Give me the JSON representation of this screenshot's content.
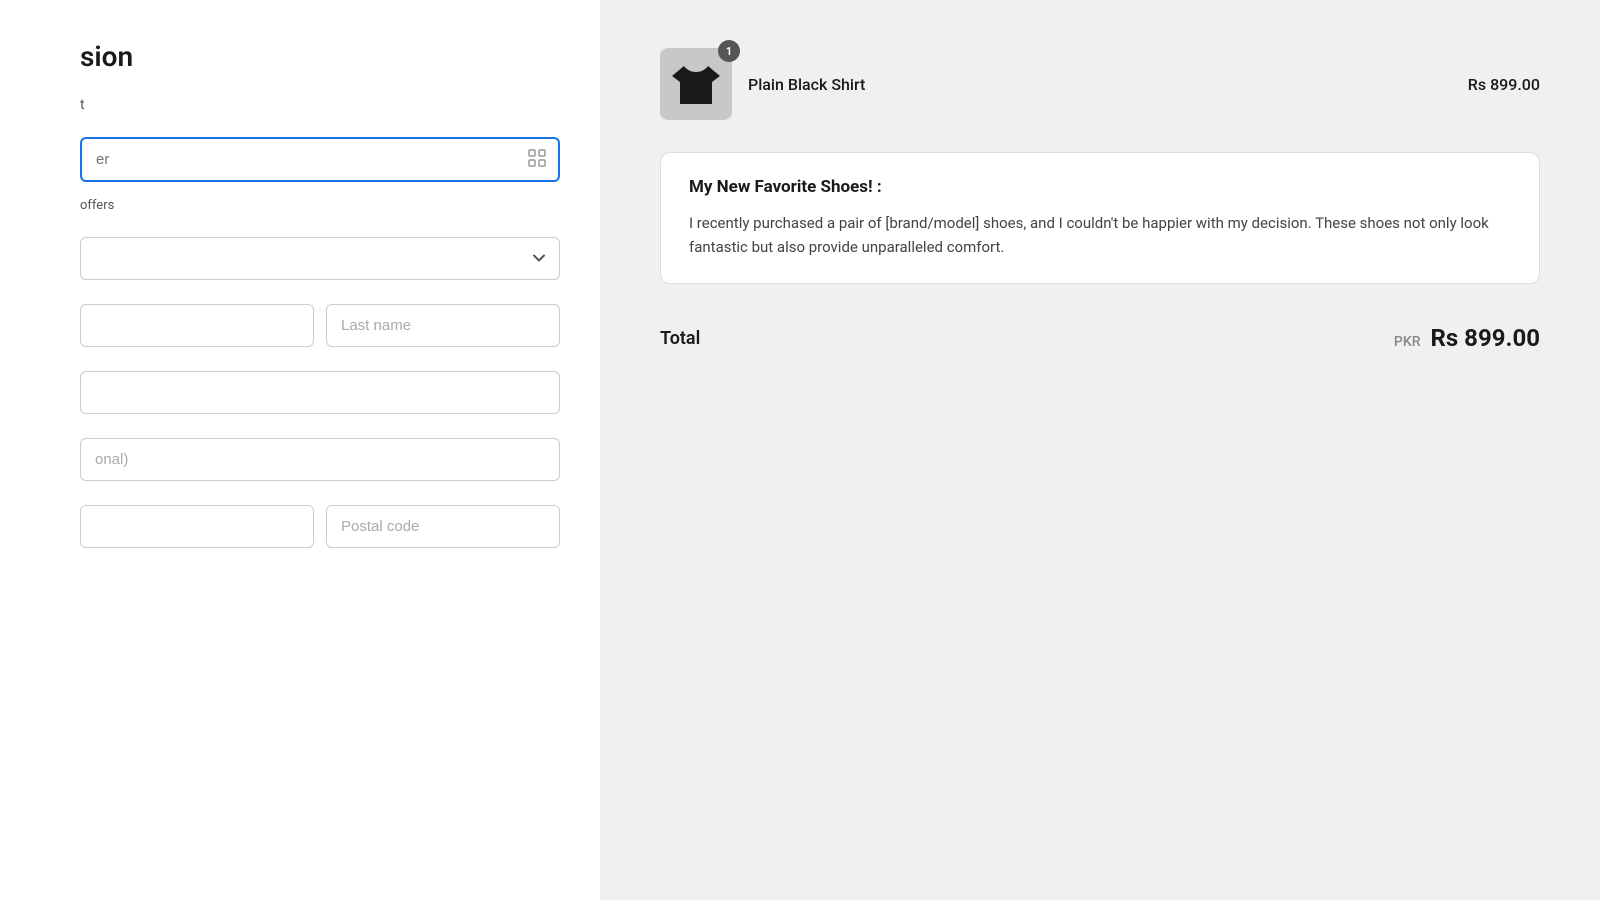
{
  "left": {
    "title": "sion",
    "subtitle": "t",
    "email_placeholder": "er",
    "offers_text": "offers",
    "country_placeholder": "",
    "first_name_placeholder": "",
    "last_name_placeholder": "Last name",
    "address_placeholder": "",
    "apartment_placeholder": "onal)",
    "city_placeholder": "",
    "postal_placeholder": "Postal code"
  },
  "right": {
    "product": {
      "name": "Plain Black Shirt",
      "price": "Rs 899.00",
      "quantity": "1"
    },
    "review": {
      "title": "My New Favorite Shoes! :",
      "body": "I recently purchased a pair of [brand/model] shoes, and I couldn't be happier with my decision. These shoes not only look fantastic but also provide unparalleled comfort."
    },
    "total": {
      "label": "Total",
      "currency": "PKR",
      "amount": "Rs 899.00"
    }
  }
}
